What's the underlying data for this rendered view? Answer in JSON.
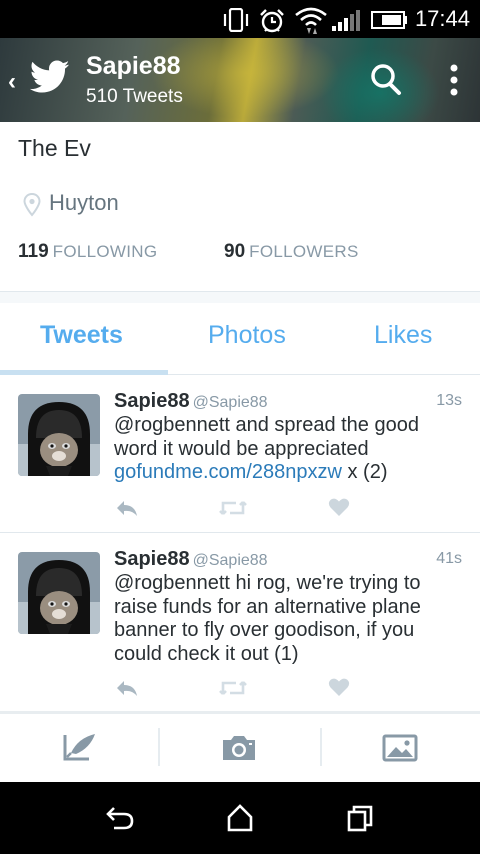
{
  "status_bar": {
    "time": "17:44",
    "icons": [
      "vibrate-icon",
      "alarm-icon",
      "wifi-icon",
      "signal-icon",
      "battery-icon"
    ]
  },
  "header": {
    "screen_name": "Sapie88",
    "tweet_count": "510 Tweets",
    "icons": [
      "back-chevron-icon",
      "twitter-bird-icon",
      "search-icon",
      "more-vert-icon"
    ]
  },
  "profile": {
    "bio": "The Ev",
    "location": "Huyton",
    "following_count": "119",
    "following_label": "FOLLOWING",
    "followers_count": "90",
    "followers_label": "FOLLOWERS"
  },
  "tabs": [
    {
      "label": "Tweets",
      "active": true
    },
    {
      "label": "Photos",
      "active": false
    },
    {
      "label": "Likes",
      "active": false
    }
  ],
  "tweets": [
    {
      "name": "Sapie88",
      "handle": "@Sapie88",
      "time": "13s",
      "text_before": "@rogbennett and spread the good word it would be appreciated ",
      "link": "gofundme.com/288npxzw",
      "text_after": " x (2)"
    },
    {
      "name": "Sapie88",
      "handle": "@Sapie88",
      "time": "41s",
      "text_before": "@rogbennett hi rog, we're trying to raise funds for an alternative plane banner to fly over goodison, if you could check it out (1)",
      "link": "",
      "text_after": ""
    }
  ],
  "tweet_actions": [
    "reply-icon",
    "retweet-icon",
    "like-heart-icon"
  ],
  "compose_bar": [
    "compose-tweet-icon",
    "camera-icon",
    "photo-gallery-icon"
  ],
  "nav_bar": [
    "back-icon",
    "home-icon",
    "recents-icon"
  ],
  "colors": {
    "accent": "#55acee",
    "link": "#2b7bb9",
    "muted": "#8899a6",
    "text": "#292f33",
    "icon_gray": "#aab8c2"
  }
}
